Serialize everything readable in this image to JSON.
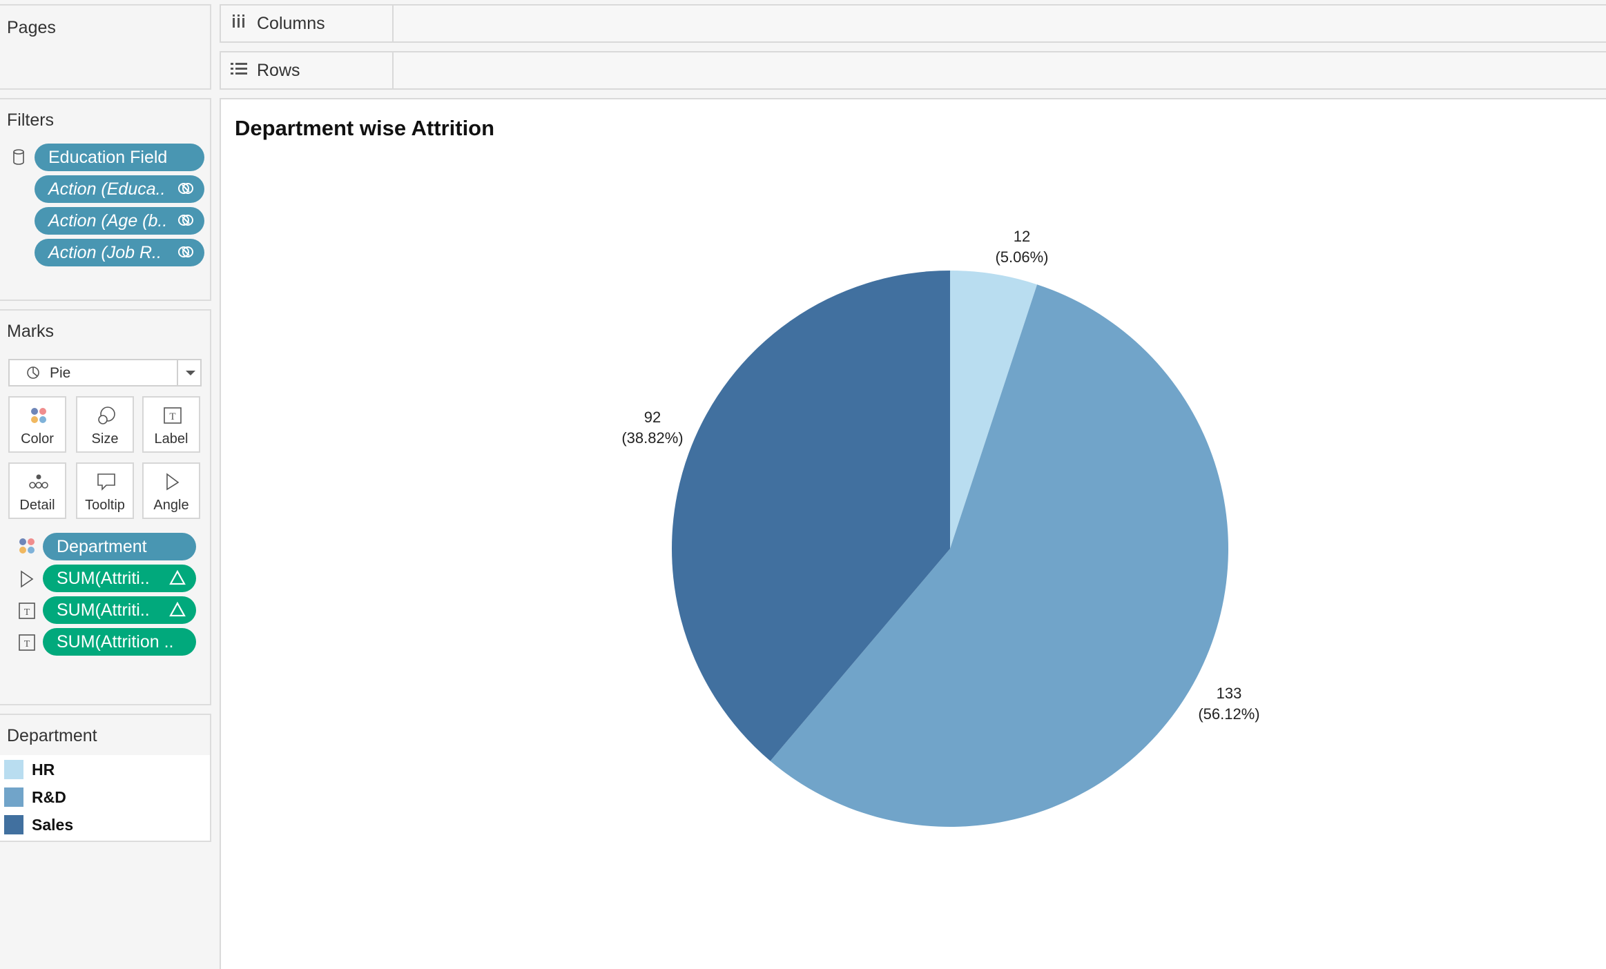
{
  "pages": {
    "title": "Pages"
  },
  "shelves": {
    "columns": "Columns",
    "rows": "Rows"
  },
  "filters": {
    "title": "Filters",
    "items": [
      {
        "label": "Education Field",
        "italic": false
      },
      {
        "label": "Action (Educa..",
        "italic": true
      },
      {
        "label": "Action (Age (b..",
        "italic": true
      },
      {
        "label": "Action (Job R..",
        "italic": true
      }
    ]
  },
  "marks": {
    "title": "Marks",
    "type": "Pie",
    "cards": [
      "Color",
      "Size",
      "Label",
      "Detail",
      "Tooltip",
      "Angle"
    ],
    "fields": [
      {
        "label": "Department",
        "kind": "color"
      },
      {
        "label": "SUM(Attriti..",
        "kind": "angle"
      },
      {
        "label": "SUM(Attriti..",
        "kind": "label"
      },
      {
        "label": "SUM(Attrition ..",
        "kind": "label"
      }
    ]
  },
  "legend": {
    "title": "Department",
    "items": [
      {
        "label": "HR",
        "color": "#b9ddf0"
      },
      {
        "label": "R&D",
        "color": "#71a4c9"
      },
      {
        "label": "Sales",
        "color": "#41709f"
      }
    ]
  },
  "viz": {
    "title": "Department wise Attrition"
  },
  "chart_data": {
    "type": "pie",
    "title": "Department wise Attrition",
    "slices": [
      {
        "category": "HR",
        "value": 12,
        "percent": "5.06%",
        "color": "#b9ddf0"
      },
      {
        "category": "R&D",
        "value": 133,
        "percent": "56.12%",
        "color": "#71a4c9"
      },
      {
        "category": "Sales",
        "value": 92,
        "percent": "38.82%",
        "color": "#41709f"
      }
    ],
    "labels": [
      {
        "value": "12",
        "percent": "(5.06%)"
      },
      {
        "value": "133",
        "percent": "(56.12%)"
      },
      {
        "value": "92",
        "percent": "(38.82%)"
      }
    ],
    "start_angle_deg": 0,
    "direction": "clockwise"
  }
}
